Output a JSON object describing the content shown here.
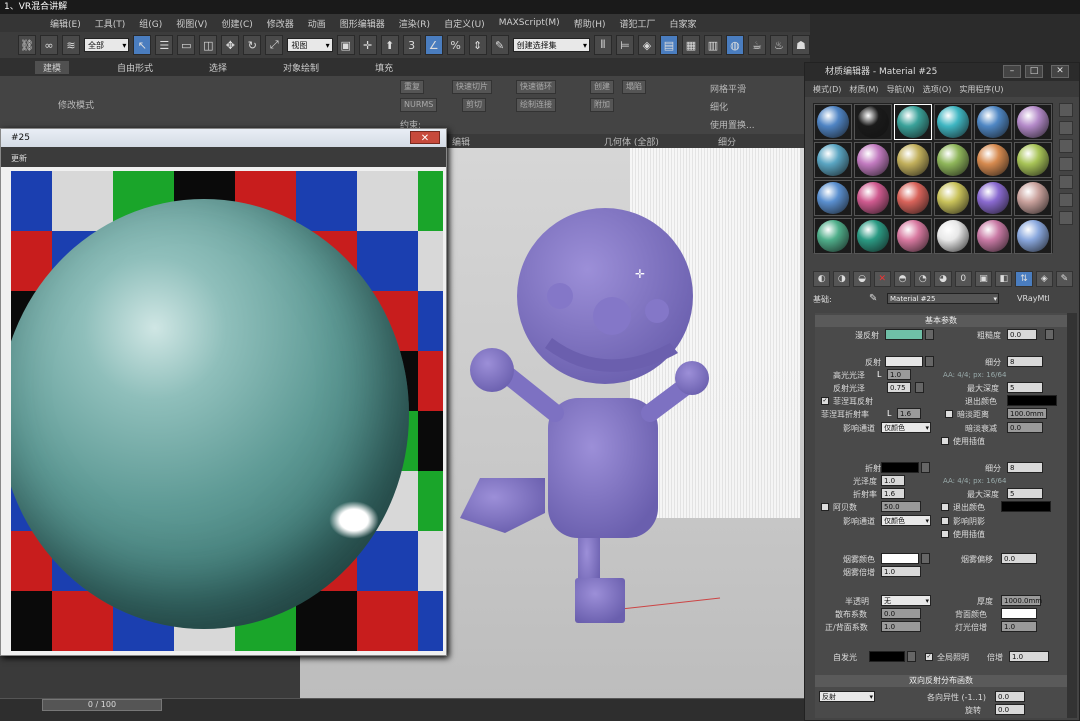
{
  "window_title": "1、VR混合讲解",
  "menu": [
    "编辑(E)",
    "工具(T)",
    "组(G)",
    "视图(V)",
    "创建(C)",
    "修改器",
    "动画",
    "图形编辑器",
    "渲染(R)",
    "自定义(U)",
    "MAXScript(M)",
    "帮助(H)",
    "谱犯工厂",
    "白家家"
  ],
  "toolbar": {
    "filter": "全部",
    "view": "视图",
    "selection_set": "创建选择集"
  },
  "ribbon_tabs": [
    "建模",
    "自由形式",
    "选择",
    "对象绘制",
    "填充"
  ],
  "ribbon": {
    "modify_mode": "修改模式",
    "polygon_modeling": "多边形建模",
    "edit": "编辑",
    "geometry_all": "几何体 (全部)",
    "subdivision": "细分",
    "mesh_smooth": "网格平滑",
    "tessellate": "细化",
    "use_displacement": "使用置换...",
    "constraint": "约束:",
    "repeat": "重复",
    "quickslice": "快速切片",
    "swiftloop": "快速循环",
    "nurms": "NURMS",
    "cut": "剪切",
    "paint_connect": "绘制连接",
    "create": "创建",
    "collapse": "塌陷",
    "attach": "附加",
    "detach": "分离",
    "pins": "平面化"
  },
  "render_window": {
    "title": "#25",
    "toolbar_label": "更新"
  },
  "timeline": {
    "frame": "0 / 100"
  },
  "material_editor": {
    "title": "材质编辑器 - Material #25",
    "menu": [
      "模式(D)",
      "材质(M)",
      "导航(N)",
      "选项(O)",
      "实用程序(U)"
    ],
    "base_label": "基础:",
    "material_name": "Material #25",
    "material_type": "VRayMtl",
    "colors": {
      "diffuse": "#6fbfa7",
      "reflect": "#e6e6e6",
      "exit": "#000000",
      "refract": "#000000",
      "fog": "#ffffff",
      "selfillum": "#000000",
      "back": "#ffffff"
    },
    "slots": [
      [
        "#4f84c4",
        "#1a1a1a",
        "#3aa29a",
        "#3fb6c2",
        "#4f87c4",
        "#b48ac9"
      ],
      [
        "#5aa5c2",
        "#c27bc0",
        "#c2b05c",
        "#8fb65a",
        "#d68a4f",
        "#a8c457"
      ],
      [
        "#5a8fcf",
        "#cf5a8f",
        "#d8635a",
        "#c9c25a",
        "#8a6ad0",
        "#c9a19c"
      ],
      [
        "#4fae8a",
        "#2b9a83",
        "#d879a0",
        "#e8e8e8",
        "#c97aa5",
        "#8aa8de"
      ]
    ],
    "basic_params": "基本参数",
    "diffuse_label": "漫反射",
    "roughness_label": "粗糙度",
    "roughness_val": "0.0",
    "reflect_label": "反射",
    "subdiv_label": "细分",
    "reflect_subdiv": "8",
    "hilight_gloss_label": "高光光泽",
    "hilight_gloss_lock": "L",
    "hilight_gloss_val": "1.0",
    "aa_info": "AA: 4/4; px: 16/64",
    "refl_gloss_label": "反射光泽",
    "refl_gloss_val": "0.75",
    "max_depth_label": "最大深度",
    "reflect_depth": "5",
    "fresnel_label": "菲涅耳反射",
    "exit_color_label": "退出颜色",
    "fresnel_ior_label": "菲涅耳折射率",
    "fresnel_ior_lock": "L",
    "fresnel_ior_val": "1.6",
    "dim_dist_label": "暗淡距离",
    "dim_dist_val": "100.0mm",
    "affect_channels_label": "影响通道",
    "affect_channels_val": "仅颜色",
    "dim_falloff_label": "暗淡衰减",
    "dim_falloff_val": "0.0",
    "use_interp_label": "使用插值",
    "refract_label": "折射",
    "refract_subdiv": "8",
    "gloss_label": "光泽度",
    "refract_gloss_val": "1.0",
    "refract_aa": "AA: 4/4; px: 16/64",
    "ior_label": "折射率",
    "ior_val": "1.6",
    "refract_depth": "5",
    "abbe_label": "阿贝数",
    "abbe_val": "50.0",
    "refract_exit_label": "退出颜色",
    "affect_channels2_val": "仅颜色",
    "affect_shadows_label": "影响阴影",
    "use_interp2_label": "使用插值",
    "fog_color_label": "烟雾颜色",
    "fog_bias_label": "烟雾偏移",
    "fog_bias_val": "0.0",
    "fog_mult_label": "烟雾倍增",
    "fog_mult_val": "1.0",
    "translucency_label": "半透明",
    "translucency_val": "无",
    "thickness_label": "厚度",
    "thickness_val": "1000.0mm",
    "scatter_label": "散布系数",
    "scatter_val": "0.0",
    "back_color_label": "背面颜色",
    "fb_coef_label": "正/背面系数",
    "fb_coef_val": "1.0",
    "light_mult_label": "灯光倍增",
    "light_mult_val": "1.0",
    "selfillum_label": "自发光",
    "gi_label": "全局照明",
    "mult_label": "倍增",
    "mult_val": "1.0",
    "brdf_header": "双向反射分布函数",
    "brdf_type": "反射",
    "anisotropy_label": "各向异性 (-1..1)",
    "anisotropy_val": "0.0",
    "rotation_label": "旋转",
    "rotation_val": "0.0"
  }
}
